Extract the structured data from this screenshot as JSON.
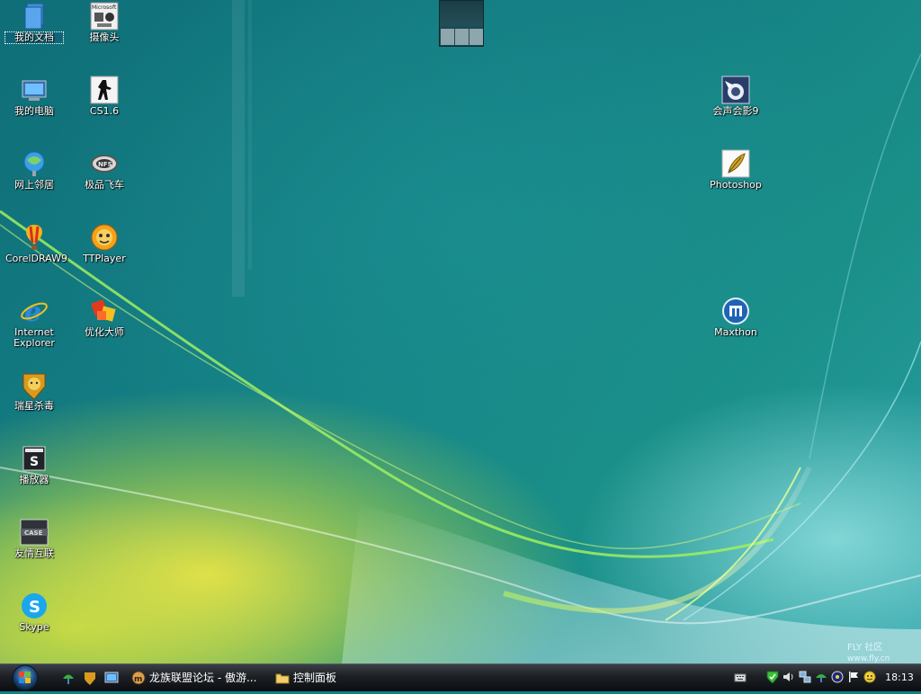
{
  "desktop": {
    "icons": [
      {
        "label": "我的文档",
        "icon": "my-documents-icon"
      },
      {
        "label": "摄像头",
        "icon": "webcam-icon",
        "badge": "Microsoft"
      },
      {
        "label": "我的电脑",
        "icon": "my-computer-icon"
      },
      {
        "label": "CS1.6",
        "icon": "counter-strike-icon"
      },
      {
        "label": "网上邻居",
        "icon": "network-icon"
      },
      {
        "label": "极品飞车",
        "icon": "need-for-speed-icon"
      },
      {
        "label": "CorelDRAW9",
        "icon": "coreldraw-balloon-icon"
      },
      {
        "label": "TTPlayer",
        "icon": "ttplayer-icon"
      },
      {
        "label": "Internet\nExplorer",
        "icon": "internet-explorer-icon"
      },
      {
        "label": "优化大师",
        "icon": "optimizer-icon"
      },
      {
        "label": "瑞星杀毒",
        "icon": "rising-antivirus-icon"
      },
      {
        "label": "播放器",
        "icon": "media-player-icon"
      },
      {
        "label": "友情互联",
        "icon": "friends-link-icon"
      },
      {
        "label": "Skype",
        "icon": "skype-icon"
      },
      {
        "label": "会声会影9",
        "icon": "ulead-videostudio-icon"
      },
      {
        "label": "Photoshop",
        "icon": "photoshop-feather-icon"
      },
      {
        "label": "Maxthon",
        "icon": "maxthon-icon"
      }
    ],
    "watermark_line1": "FLY 社区",
    "watermark_line2": "www.fly.cn"
  },
  "taskbar": {
    "tasks": [
      {
        "label": "龙族联盟论坛 - 傲游...",
        "icon": "maxthon-icon"
      },
      {
        "label": "控制面板",
        "icon": "folder-icon"
      }
    ],
    "quick_launch": [
      "network-icon",
      "rising-antivirus-icon",
      "show-desktop-icon"
    ],
    "tray": [
      "keyboard-icon",
      "security-shield-icon",
      "volume-icon",
      "network-status-icon",
      "network-icon",
      "wireless-icon",
      "flag-icon",
      "smiley-icon"
    ],
    "clock": "18:13"
  },
  "colors": {
    "desktop": "#127f82",
    "taskbar": "#1c2025"
  }
}
